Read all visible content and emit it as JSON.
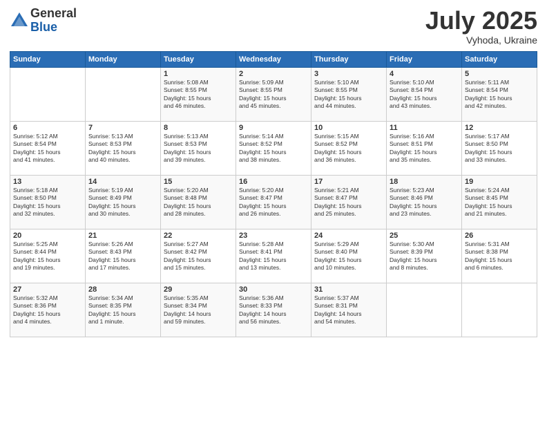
{
  "logo": {
    "general": "General",
    "blue": "Blue"
  },
  "title": "July 2025",
  "location": "Vyhoda, Ukraine",
  "headers": [
    "Sunday",
    "Monday",
    "Tuesday",
    "Wednesday",
    "Thursday",
    "Friday",
    "Saturday"
  ],
  "weeks": [
    [
      {
        "day": "",
        "content": ""
      },
      {
        "day": "",
        "content": ""
      },
      {
        "day": "1",
        "content": "Sunrise: 5:08 AM\nSunset: 8:55 PM\nDaylight: 15 hours\nand 46 minutes."
      },
      {
        "day": "2",
        "content": "Sunrise: 5:09 AM\nSunset: 8:55 PM\nDaylight: 15 hours\nand 45 minutes."
      },
      {
        "day": "3",
        "content": "Sunrise: 5:10 AM\nSunset: 8:55 PM\nDaylight: 15 hours\nand 44 minutes."
      },
      {
        "day": "4",
        "content": "Sunrise: 5:10 AM\nSunset: 8:54 PM\nDaylight: 15 hours\nand 43 minutes."
      },
      {
        "day": "5",
        "content": "Sunrise: 5:11 AM\nSunset: 8:54 PM\nDaylight: 15 hours\nand 42 minutes."
      }
    ],
    [
      {
        "day": "6",
        "content": "Sunrise: 5:12 AM\nSunset: 8:54 PM\nDaylight: 15 hours\nand 41 minutes."
      },
      {
        "day": "7",
        "content": "Sunrise: 5:13 AM\nSunset: 8:53 PM\nDaylight: 15 hours\nand 40 minutes."
      },
      {
        "day": "8",
        "content": "Sunrise: 5:13 AM\nSunset: 8:53 PM\nDaylight: 15 hours\nand 39 minutes."
      },
      {
        "day": "9",
        "content": "Sunrise: 5:14 AM\nSunset: 8:52 PM\nDaylight: 15 hours\nand 38 minutes."
      },
      {
        "day": "10",
        "content": "Sunrise: 5:15 AM\nSunset: 8:52 PM\nDaylight: 15 hours\nand 36 minutes."
      },
      {
        "day": "11",
        "content": "Sunrise: 5:16 AM\nSunset: 8:51 PM\nDaylight: 15 hours\nand 35 minutes."
      },
      {
        "day": "12",
        "content": "Sunrise: 5:17 AM\nSunset: 8:50 PM\nDaylight: 15 hours\nand 33 minutes."
      }
    ],
    [
      {
        "day": "13",
        "content": "Sunrise: 5:18 AM\nSunset: 8:50 PM\nDaylight: 15 hours\nand 32 minutes."
      },
      {
        "day": "14",
        "content": "Sunrise: 5:19 AM\nSunset: 8:49 PM\nDaylight: 15 hours\nand 30 minutes."
      },
      {
        "day": "15",
        "content": "Sunrise: 5:20 AM\nSunset: 8:48 PM\nDaylight: 15 hours\nand 28 minutes."
      },
      {
        "day": "16",
        "content": "Sunrise: 5:20 AM\nSunset: 8:47 PM\nDaylight: 15 hours\nand 26 minutes."
      },
      {
        "day": "17",
        "content": "Sunrise: 5:21 AM\nSunset: 8:47 PM\nDaylight: 15 hours\nand 25 minutes."
      },
      {
        "day": "18",
        "content": "Sunrise: 5:23 AM\nSunset: 8:46 PM\nDaylight: 15 hours\nand 23 minutes."
      },
      {
        "day": "19",
        "content": "Sunrise: 5:24 AM\nSunset: 8:45 PM\nDaylight: 15 hours\nand 21 minutes."
      }
    ],
    [
      {
        "day": "20",
        "content": "Sunrise: 5:25 AM\nSunset: 8:44 PM\nDaylight: 15 hours\nand 19 minutes."
      },
      {
        "day": "21",
        "content": "Sunrise: 5:26 AM\nSunset: 8:43 PM\nDaylight: 15 hours\nand 17 minutes."
      },
      {
        "day": "22",
        "content": "Sunrise: 5:27 AM\nSunset: 8:42 PM\nDaylight: 15 hours\nand 15 minutes."
      },
      {
        "day": "23",
        "content": "Sunrise: 5:28 AM\nSunset: 8:41 PM\nDaylight: 15 hours\nand 13 minutes."
      },
      {
        "day": "24",
        "content": "Sunrise: 5:29 AM\nSunset: 8:40 PM\nDaylight: 15 hours\nand 10 minutes."
      },
      {
        "day": "25",
        "content": "Sunrise: 5:30 AM\nSunset: 8:39 PM\nDaylight: 15 hours\nand 8 minutes."
      },
      {
        "day": "26",
        "content": "Sunrise: 5:31 AM\nSunset: 8:38 PM\nDaylight: 15 hours\nand 6 minutes."
      }
    ],
    [
      {
        "day": "27",
        "content": "Sunrise: 5:32 AM\nSunset: 8:36 PM\nDaylight: 15 hours\nand 4 minutes."
      },
      {
        "day": "28",
        "content": "Sunrise: 5:34 AM\nSunset: 8:35 PM\nDaylight: 15 hours\nand 1 minute."
      },
      {
        "day": "29",
        "content": "Sunrise: 5:35 AM\nSunset: 8:34 PM\nDaylight: 14 hours\nand 59 minutes."
      },
      {
        "day": "30",
        "content": "Sunrise: 5:36 AM\nSunset: 8:33 PM\nDaylight: 14 hours\nand 56 minutes."
      },
      {
        "day": "31",
        "content": "Sunrise: 5:37 AM\nSunset: 8:31 PM\nDaylight: 14 hours\nand 54 minutes."
      },
      {
        "day": "",
        "content": ""
      },
      {
        "day": "",
        "content": ""
      }
    ]
  ]
}
